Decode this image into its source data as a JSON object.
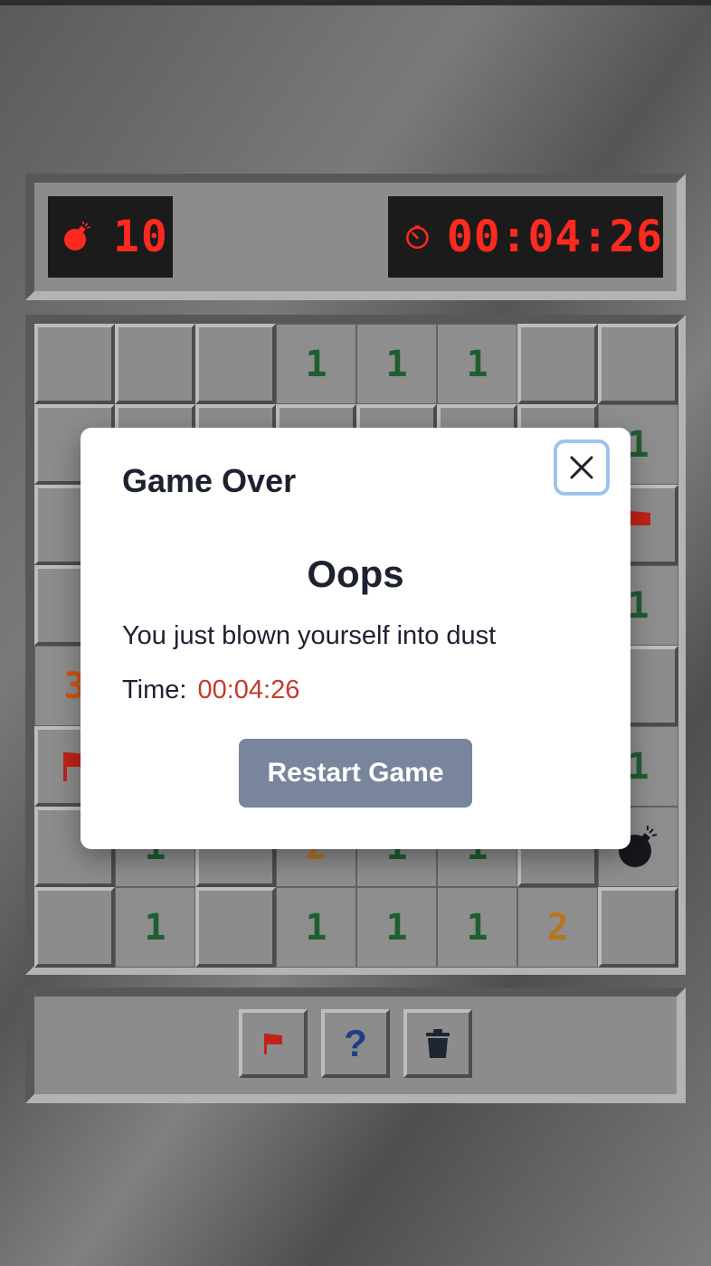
{
  "status": {
    "mines_remaining": "10",
    "elapsed_time": "00:04:26",
    "mine_icon": "bomb-icon",
    "timer_icon": "stopwatch-icon",
    "lcd_color": "#ff2a1f"
  },
  "board": {
    "rows": 8,
    "cols": 8,
    "cells": [
      [
        "closed",
        "closed",
        "closed",
        "1",
        "1",
        "1",
        "closed",
        "closed"
      ],
      [
        "closed",
        "closed",
        "closed",
        "closed",
        "closed",
        "closed",
        "closed",
        "1"
      ],
      [
        "closed",
        "closed",
        "closed",
        "closed",
        "closed",
        "closed",
        "closed",
        "flag"
      ],
      [
        "closed",
        "closed",
        "closed",
        "closed",
        "closed",
        "closed",
        "closed",
        "1"
      ],
      [
        "3",
        "closed",
        "closed",
        "closed",
        "closed",
        "closed",
        "closed",
        "closed"
      ],
      [
        "flag",
        "closed",
        "closed",
        "closed",
        "closed",
        "closed",
        "closed",
        "1"
      ],
      [
        "closed",
        "1",
        "closed",
        "2",
        "1",
        "1",
        "closed",
        "mine"
      ],
      [
        "closed",
        "1",
        "closed",
        "1",
        "1",
        "1",
        "2",
        "closed"
      ]
    ],
    "number_colors": {
      "1": "#1f5e30",
      "2": "#b7751e",
      "3": "#cf5518"
    }
  },
  "tools": [
    {
      "name": "flag-tool",
      "icon": "flag-icon"
    },
    {
      "name": "question-tool",
      "label": "?",
      "icon": "question-mark-icon"
    },
    {
      "name": "clear-tool",
      "icon": "trash-icon"
    }
  ],
  "modal": {
    "title": "Game Over",
    "heading": "Oops",
    "message": "You just blown yourself into dust",
    "time_label": "Time:",
    "time_value": "00:04:26",
    "restart_label": "Restart Game",
    "close_icon": "close-icon",
    "accent_color": "#c53a2e",
    "button_color": "#78859c"
  }
}
